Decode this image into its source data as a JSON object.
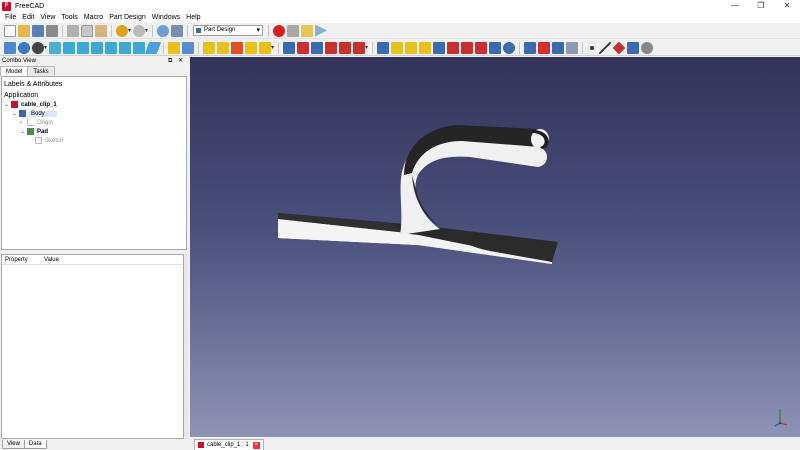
{
  "window": {
    "title": "FreeCAD",
    "minimize_glyph": "—",
    "restore_glyph": "❐",
    "close_glyph": "✕"
  },
  "menu": [
    "File",
    "Edit",
    "View",
    "Tools",
    "Macro",
    "Part Design",
    "Windows",
    "Help"
  ],
  "toolbar": {
    "workbench": "Part Design"
  },
  "combo_view": {
    "title": "Combo View",
    "tabs": [
      "Model",
      "Tasks"
    ],
    "labels_header": "Labels & Attributes",
    "application": "Application",
    "tree": [
      {
        "label": "cable_clip_1",
        "expanded": true
      },
      {
        "label": "Body",
        "expanded": true
      },
      {
        "label": "Origin",
        "expanded": false
      },
      {
        "label": "Pad",
        "expanded": true
      },
      {
        "label": "Sketch"
      }
    ],
    "property_header": [
      "Property",
      "Value"
    ],
    "bottom_tabs": [
      "View",
      "Data"
    ]
  },
  "document_tab": {
    "label": "cable_clip_1 : 1"
  },
  "colors": {
    "sketch_red": "#c8102e",
    "view_top": "#33335a",
    "view_bottom": "#8f93b6",
    "selection": "#dbe6f7"
  }
}
